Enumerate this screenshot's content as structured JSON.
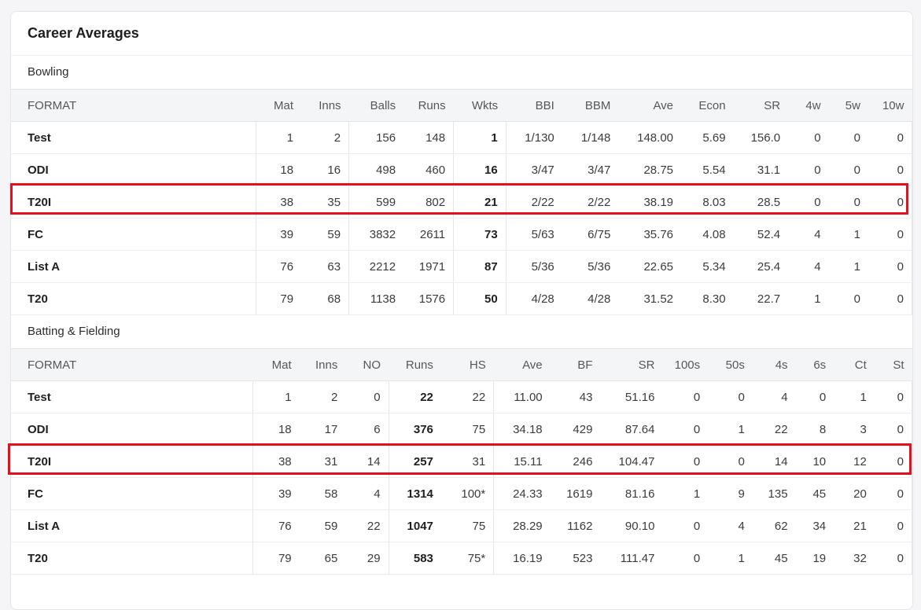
{
  "card": {
    "title": "Career Averages"
  },
  "bowling": {
    "title": "Bowling",
    "headers": [
      "FORMAT",
      "Mat",
      "Inns",
      "Balls",
      "Runs",
      "Wkts",
      "BBI",
      "BBM",
      "Ave",
      "Econ",
      "SR",
      "4w",
      "5w",
      "10w"
    ],
    "rows": [
      [
        "Test",
        "1",
        "2",
        "156",
        "148",
        "1",
        "1/130",
        "1/148",
        "148.00",
        "5.69",
        "156.0",
        "0",
        "0",
        "0"
      ],
      [
        "ODI",
        "18",
        "16",
        "498",
        "460",
        "16",
        "3/47",
        "3/47",
        "28.75",
        "5.54",
        "31.1",
        "0",
        "0",
        "0"
      ],
      [
        "T20I",
        "38",
        "35",
        "599",
        "802",
        "21",
        "2/22",
        "2/22",
        "38.19",
        "8.03",
        "28.5",
        "0",
        "0",
        "0"
      ],
      [
        "FC",
        "39",
        "59",
        "3832",
        "2611",
        "73",
        "5/63",
        "6/75",
        "35.76",
        "4.08",
        "52.4",
        "4",
        "1",
        "0"
      ],
      [
        "List A",
        "76",
        "63",
        "2212",
        "1971",
        "87",
        "5/36",
        "5/36",
        "22.65",
        "5.34",
        "25.4",
        "4",
        "1",
        "0"
      ],
      [
        "T20",
        "79",
        "68",
        "1138",
        "1576",
        "50",
        "4/28",
        "4/28",
        "31.52",
        "8.30",
        "22.7",
        "1",
        "0",
        "0"
      ]
    ]
  },
  "batting": {
    "title": "Batting & Fielding",
    "headers": [
      "FORMAT",
      "Mat",
      "Inns",
      "NO",
      "Runs",
      "HS",
      "Ave",
      "BF",
      "SR",
      "100s",
      "50s",
      "4s",
      "6s",
      "Ct",
      "St"
    ],
    "rows": [
      [
        "Test",
        "1",
        "2",
        "0",
        "22",
        "22",
        "11.00",
        "43",
        "51.16",
        "0",
        "0",
        "4",
        "0",
        "1",
        "0"
      ],
      [
        "ODI",
        "18",
        "17",
        "6",
        "376",
        "75",
        "34.18",
        "429",
        "87.64",
        "0",
        "1",
        "22",
        "8",
        "3",
        "0"
      ],
      [
        "T20I",
        "38",
        "31",
        "14",
        "257",
        "31",
        "15.11",
        "246",
        "104.47",
        "0",
        "0",
        "14",
        "10",
        "12",
        "0"
      ],
      [
        "FC",
        "39",
        "58",
        "4",
        "1314",
        "100*",
        "24.33",
        "1619",
        "81.16",
        "1",
        "9",
        "135",
        "45",
        "20",
        "0"
      ],
      [
        "List A",
        "76",
        "59",
        "22",
        "1047",
        "75",
        "28.29",
        "1162",
        "90.10",
        "0",
        "4",
        "62",
        "34",
        "21",
        "0"
      ],
      [
        "T20",
        "79",
        "65",
        "29",
        "583",
        "75*",
        "16.19",
        "523",
        "111.47",
        "0",
        "1",
        "45",
        "19",
        "32",
        "0"
      ]
    ]
  },
  "highlight": {
    "color": "#e3101e",
    "rows": [
      "bowling:T20I",
      "batting:T20I"
    ]
  }
}
